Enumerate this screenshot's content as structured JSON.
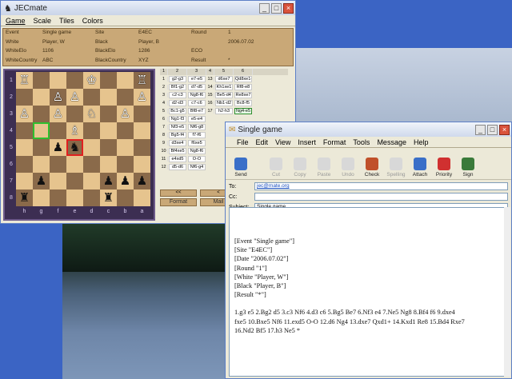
{
  "chess": {
    "title": "JECmate",
    "menu": [
      "Game",
      "Scale",
      "Tiles",
      "Colors"
    ],
    "header": [
      [
        "Event",
        "Single game",
        "Site",
        "E4EC",
        "Round",
        "1"
      ],
      [
        "White",
        "Player, W",
        "Black",
        "Player, B",
        "",
        "2006.07.02"
      ],
      [
        "WhiteElo",
        "1106",
        "BlackElo",
        "1286",
        "ECO",
        ""
      ],
      [
        "WhiteCountry",
        "ABC",
        "BlackCountry",
        "XYZ",
        "Result",
        "*"
      ]
    ],
    "ranks": [
      "1",
      "2",
      "3",
      "4",
      "5",
      "6",
      "7",
      "8"
    ],
    "files": [
      "h",
      "g",
      "f",
      "e",
      "d",
      "c",
      "b",
      "a"
    ],
    "board": [
      [
        "♖",
        "",
        "",
        "",
        "♔",
        "",
        "",
        "♖"
      ],
      [
        "",
        "",
        "♙",
        "♙",
        "",
        "",
        "",
        "♙"
      ],
      [
        "♙",
        "",
        "♙",
        "",
        "♘",
        "",
        "♙",
        ""
      ],
      [
        "",
        "",
        "",
        "♗",
        "",
        "",
        "",
        ""
      ],
      [
        "",
        "",
        "♟",
        "♞",
        "",
        "",
        "",
        ""
      ],
      [
        "",
        "",
        "",
        "",
        "",
        "",
        "",
        ""
      ],
      [
        "",
        "♟",
        "",
        "",
        "",
        "♟",
        "♟",
        "♟"
      ],
      [
        "♜",
        "",
        "",
        "",
        "",
        "♜",
        "",
        ""
      ]
    ],
    "move_cols": [
      "1",
      "2",
      "3",
      "4",
      "5",
      "6"
    ],
    "moves": [
      [
        "1",
        "g2-g3",
        "e7-e5",
        "13",
        "d6xe7",
        "Qd8xe1+"
      ],
      [
        "2",
        "Bf1-g2",
        "d7-d5",
        "14",
        "Kh1xe1",
        "Rf8-e8"
      ],
      [
        "3",
        "c2-c3",
        "Ng8-f6",
        "15",
        "Be5-d4",
        "Re8xe7"
      ],
      [
        "4",
        "d2-d3",
        "c7-c6",
        "16",
        "Nb1-d2",
        "Bc8-f5"
      ],
      [
        "5",
        "Bc1-g5",
        "Bf8-e7",
        "17",
        "h2-h3",
        "Ng4-e5"
      ],
      [
        "6",
        "Ng1-f3",
        "e5-e4",
        "",
        "",
        ""
      ],
      [
        "7",
        "Nf3-e5",
        "Nf6-g8",
        "",
        "",
        ""
      ],
      [
        "8",
        "Bg5-f4",
        "f7-f6",
        "",
        "",
        ""
      ],
      [
        "9",
        "d3xe4",
        "f6xe5",
        "",
        "",
        ""
      ],
      [
        "10",
        "Bf4xe5",
        "Ng8-f6",
        "",
        "",
        ""
      ],
      [
        "11",
        "e4xd5",
        "O-O",
        "",
        "",
        ""
      ],
      [
        "12",
        "d5-d6",
        "Nf6-g4",
        "",
        "",
        ""
      ]
    ],
    "nav": [
      "<<",
      "<",
      "Format",
      "Mail"
    ]
  },
  "mail": {
    "title": "Single game",
    "menu": [
      "File",
      "Edit",
      "View",
      "Insert",
      "Format",
      "Tools",
      "Message",
      "Help"
    ],
    "toolbar": [
      "Send",
      "Cut",
      "Copy",
      "Paste",
      "Undo",
      "Check",
      "Spelling",
      "Attach",
      "Priority",
      "Sign"
    ],
    "to_label": "To:",
    "to": "jec@mate.org",
    "cc_label": "Cc:",
    "cc": "",
    "subject_label": "Subject:",
    "subject": "Single game",
    "body": [
      "[Event \"Single game\"]",
      "[Site \"E4EC\"]",
      "[Date \"2006.07.02\"]",
      "[Round \"1\"]",
      "[White \"Player, W\"]",
      "[Black \"Player, B\"]",
      "[Result \"*\"]",
      "",
      "1.g3 e5 2.Bg2 d5 3.c3 Nf6 4.d3 c6 5.Bg5 Be7 6.Nf3 e4 7.Ne5 Ng8 8.Bf4 f6 9.dxe4",
      "fxe5 10.Bxe5 Nf6 11.exd5 O-O 12.d6 Ng4 13.dxe7 Qxd1+ 14.Kxd1 Re8 15.Bd4 Rxe7",
      "16.Nd2 Bf5 17.h3 Ne5 *"
    ]
  }
}
